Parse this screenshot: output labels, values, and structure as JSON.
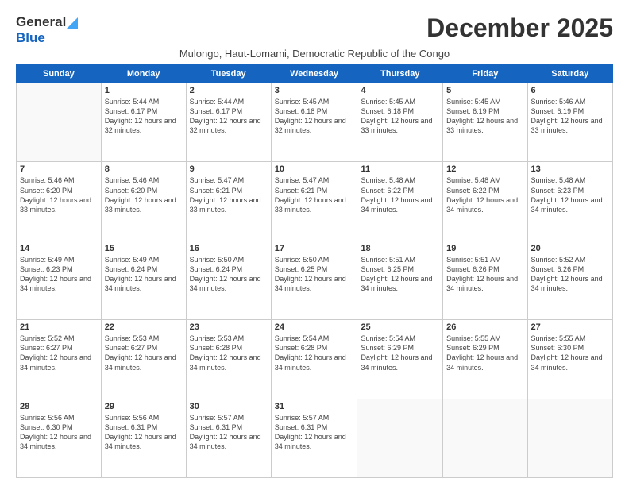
{
  "logo": {
    "general": "General",
    "blue": "Blue"
  },
  "title": "December 2025",
  "subtitle": "Mulongo, Haut-Lomami, Democratic Republic of the Congo",
  "weekdays": [
    "Sunday",
    "Monday",
    "Tuesday",
    "Wednesday",
    "Thursday",
    "Friday",
    "Saturday"
  ],
  "weeks": [
    [
      {
        "day": "",
        "sunrise": "",
        "sunset": "",
        "daylight": ""
      },
      {
        "day": "1",
        "sunrise": "Sunrise: 5:44 AM",
        "sunset": "Sunset: 6:17 PM",
        "daylight": "Daylight: 12 hours and 32 minutes."
      },
      {
        "day": "2",
        "sunrise": "Sunrise: 5:44 AM",
        "sunset": "Sunset: 6:17 PM",
        "daylight": "Daylight: 12 hours and 32 minutes."
      },
      {
        "day": "3",
        "sunrise": "Sunrise: 5:45 AM",
        "sunset": "Sunset: 6:18 PM",
        "daylight": "Daylight: 12 hours and 32 minutes."
      },
      {
        "day": "4",
        "sunrise": "Sunrise: 5:45 AM",
        "sunset": "Sunset: 6:18 PM",
        "daylight": "Daylight: 12 hours and 33 minutes."
      },
      {
        "day": "5",
        "sunrise": "Sunrise: 5:45 AM",
        "sunset": "Sunset: 6:19 PM",
        "daylight": "Daylight: 12 hours and 33 minutes."
      },
      {
        "day": "6",
        "sunrise": "Sunrise: 5:46 AM",
        "sunset": "Sunset: 6:19 PM",
        "daylight": "Daylight: 12 hours and 33 minutes."
      }
    ],
    [
      {
        "day": "7",
        "sunrise": "Sunrise: 5:46 AM",
        "sunset": "Sunset: 6:20 PM",
        "daylight": "Daylight: 12 hours and 33 minutes."
      },
      {
        "day": "8",
        "sunrise": "Sunrise: 5:46 AM",
        "sunset": "Sunset: 6:20 PM",
        "daylight": "Daylight: 12 hours and 33 minutes."
      },
      {
        "day": "9",
        "sunrise": "Sunrise: 5:47 AM",
        "sunset": "Sunset: 6:21 PM",
        "daylight": "Daylight: 12 hours and 33 minutes."
      },
      {
        "day": "10",
        "sunrise": "Sunrise: 5:47 AM",
        "sunset": "Sunset: 6:21 PM",
        "daylight": "Daylight: 12 hours and 33 minutes."
      },
      {
        "day": "11",
        "sunrise": "Sunrise: 5:48 AM",
        "sunset": "Sunset: 6:22 PM",
        "daylight": "Daylight: 12 hours and 34 minutes."
      },
      {
        "day": "12",
        "sunrise": "Sunrise: 5:48 AM",
        "sunset": "Sunset: 6:22 PM",
        "daylight": "Daylight: 12 hours and 34 minutes."
      },
      {
        "day": "13",
        "sunrise": "Sunrise: 5:48 AM",
        "sunset": "Sunset: 6:23 PM",
        "daylight": "Daylight: 12 hours and 34 minutes."
      }
    ],
    [
      {
        "day": "14",
        "sunrise": "Sunrise: 5:49 AM",
        "sunset": "Sunset: 6:23 PM",
        "daylight": "Daylight: 12 hours and 34 minutes."
      },
      {
        "day": "15",
        "sunrise": "Sunrise: 5:49 AM",
        "sunset": "Sunset: 6:24 PM",
        "daylight": "Daylight: 12 hours and 34 minutes."
      },
      {
        "day": "16",
        "sunrise": "Sunrise: 5:50 AM",
        "sunset": "Sunset: 6:24 PM",
        "daylight": "Daylight: 12 hours and 34 minutes."
      },
      {
        "day": "17",
        "sunrise": "Sunrise: 5:50 AM",
        "sunset": "Sunset: 6:25 PM",
        "daylight": "Daylight: 12 hours and 34 minutes."
      },
      {
        "day": "18",
        "sunrise": "Sunrise: 5:51 AM",
        "sunset": "Sunset: 6:25 PM",
        "daylight": "Daylight: 12 hours and 34 minutes."
      },
      {
        "day": "19",
        "sunrise": "Sunrise: 5:51 AM",
        "sunset": "Sunset: 6:26 PM",
        "daylight": "Daylight: 12 hours and 34 minutes."
      },
      {
        "day": "20",
        "sunrise": "Sunrise: 5:52 AM",
        "sunset": "Sunset: 6:26 PM",
        "daylight": "Daylight: 12 hours and 34 minutes."
      }
    ],
    [
      {
        "day": "21",
        "sunrise": "Sunrise: 5:52 AM",
        "sunset": "Sunset: 6:27 PM",
        "daylight": "Daylight: 12 hours and 34 minutes."
      },
      {
        "day": "22",
        "sunrise": "Sunrise: 5:53 AM",
        "sunset": "Sunset: 6:27 PM",
        "daylight": "Daylight: 12 hours and 34 minutes."
      },
      {
        "day": "23",
        "sunrise": "Sunrise: 5:53 AM",
        "sunset": "Sunset: 6:28 PM",
        "daylight": "Daylight: 12 hours and 34 minutes."
      },
      {
        "day": "24",
        "sunrise": "Sunrise: 5:54 AM",
        "sunset": "Sunset: 6:28 PM",
        "daylight": "Daylight: 12 hours and 34 minutes."
      },
      {
        "day": "25",
        "sunrise": "Sunrise: 5:54 AM",
        "sunset": "Sunset: 6:29 PM",
        "daylight": "Daylight: 12 hours and 34 minutes."
      },
      {
        "day": "26",
        "sunrise": "Sunrise: 5:55 AM",
        "sunset": "Sunset: 6:29 PM",
        "daylight": "Daylight: 12 hours and 34 minutes."
      },
      {
        "day": "27",
        "sunrise": "Sunrise: 5:55 AM",
        "sunset": "Sunset: 6:30 PM",
        "daylight": "Daylight: 12 hours and 34 minutes."
      }
    ],
    [
      {
        "day": "28",
        "sunrise": "Sunrise: 5:56 AM",
        "sunset": "Sunset: 6:30 PM",
        "daylight": "Daylight: 12 hours and 34 minutes."
      },
      {
        "day": "29",
        "sunrise": "Sunrise: 5:56 AM",
        "sunset": "Sunset: 6:31 PM",
        "daylight": "Daylight: 12 hours and 34 minutes."
      },
      {
        "day": "30",
        "sunrise": "Sunrise: 5:57 AM",
        "sunset": "Sunset: 6:31 PM",
        "daylight": "Daylight: 12 hours and 34 minutes."
      },
      {
        "day": "31",
        "sunrise": "Sunrise: 5:57 AM",
        "sunset": "Sunset: 6:31 PM",
        "daylight": "Daylight: 12 hours and 34 minutes."
      },
      {
        "day": "",
        "sunrise": "",
        "sunset": "",
        "daylight": ""
      },
      {
        "day": "",
        "sunrise": "",
        "sunset": "",
        "daylight": ""
      },
      {
        "day": "",
        "sunrise": "",
        "sunset": "",
        "daylight": ""
      }
    ]
  ]
}
